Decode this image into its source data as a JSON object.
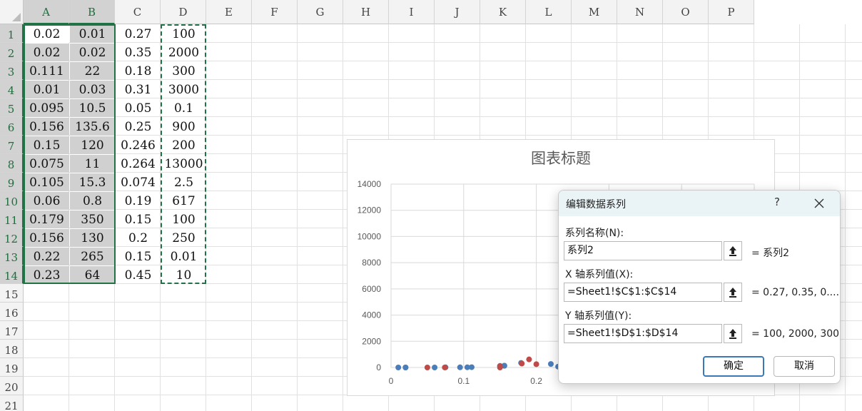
{
  "columns": [
    "A",
    "B",
    "C",
    "D",
    "E",
    "F",
    "G",
    "H",
    "I",
    "J",
    "K",
    "L",
    "M",
    "N",
    "O",
    "P"
  ],
  "rows": [
    "1",
    "2",
    "3",
    "4",
    "5",
    "6",
    "7",
    "8",
    "9",
    "10",
    "11",
    "12",
    "13",
    "14",
    "15",
    "16",
    "17",
    "18",
    "19",
    "20",
    "21"
  ],
  "cells": {
    "A": [
      "0.02",
      "0.02",
      "0.111",
      "0.01",
      "0.095",
      "0.156",
      "0.15",
      "0.075",
      "0.105",
      "0.06",
      "0.179",
      "0.156",
      "0.22",
      "0.23"
    ],
    "B": [
      "0.01",
      "0.02",
      "22",
      "0.03",
      "10.5",
      "135.6",
      "120",
      "11",
      "15.3",
      "0.8",
      "350",
      "130",
      "265",
      "64"
    ],
    "C": [
      "0.27",
      "0.35",
      "0.18",
      "0.31",
      "0.05",
      "0.25",
      "0.246",
      "0.264",
      "0.074",
      "0.19",
      "0.15",
      "0.2",
      "0.15",
      "0.45"
    ],
    "D": [
      "100",
      "2000",
      "300",
      "3000",
      "0.1",
      "900",
      "200",
      "13000",
      "2.5",
      "617",
      "100",
      "250",
      "0.01",
      "10"
    ]
  },
  "colors": {
    "selection": "#217346",
    "series1": "#4a7ebb",
    "series2": "#be4b48",
    "selected_fill": "#d0d0d0"
  },
  "chart": {
    "title": "图表标题",
    "y_ticks": [
      "14000",
      "12000",
      "10000",
      "8000",
      "6000",
      "4000",
      "2000",
      "0"
    ],
    "x_ticks": [
      "0",
      "0.1",
      "0.2"
    ]
  },
  "chart_data": {
    "type": "scatter",
    "title": "图表标题",
    "ylim": [
      0,
      14000
    ],
    "xlim": [
      0,
      0.5
    ],
    "grid": true,
    "series": [
      {
        "color": "#4a7ebb",
        "x": [
          0.02,
          0.02,
          0.111,
          0.01,
          0.095,
          0.156,
          0.15,
          0.075,
          0.105,
          0.06,
          0.179,
          0.156,
          0.22,
          0.23
        ],
        "y": [
          0.01,
          0.02,
          22,
          0.03,
          10.5,
          135.6,
          120,
          11,
          15.3,
          0.8,
          350,
          130,
          265,
          64
        ]
      },
      {
        "name": "系列2",
        "color": "#be4b48",
        "x": [
          0.27,
          0.35,
          0.18,
          0.31,
          0.05,
          0.25,
          0.246,
          0.264,
          0.074,
          0.19,
          0.15,
          0.2,
          0.15,
          0.45
        ],
        "y": [
          100,
          2000,
          300,
          3000,
          0.1,
          900,
          200,
          13000,
          2.5,
          617,
          100,
          250,
          0.01,
          10
        ]
      }
    ]
  },
  "dialog": {
    "title": "编辑数据系列",
    "help": "?",
    "name_label": "系列名称(N):",
    "name_value": "系列2",
    "name_preview": "= 系列2",
    "x_label": "X 轴系列值(X):",
    "x_value": "=Sheet1!$C$1:$C$14",
    "x_preview": "= 0.27, 0.35, 0....",
    "y_label": "Y 轴系列值(Y):",
    "y_value": "=Sheet1!$D$1:$D$14",
    "y_preview": "= 100, 2000, 300...",
    "ok": "确定",
    "cancel": "取消"
  },
  "icons": {
    "pick": "upload-arrow-icon",
    "close": "close-icon"
  }
}
